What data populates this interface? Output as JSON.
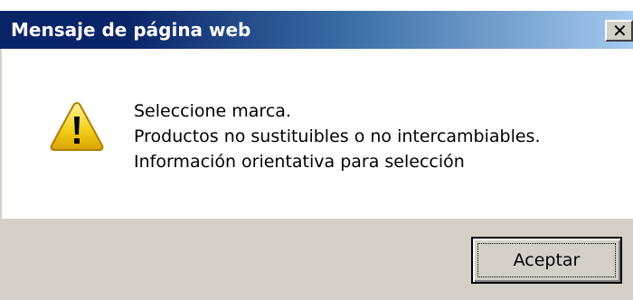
{
  "dialog": {
    "title": "Mensaje de página web",
    "close_glyph": "✕",
    "icon": "warning-icon",
    "message_lines": [
      "Seleccione marca.",
      "Productos no sustituibles o no intercambiables.",
      "Información orientativa para selección"
    ],
    "ok_label": "Aceptar"
  },
  "colors": {
    "titlebar_start": "#0a246a",
    "titlebar_end": "#a6caf0",
    "face": "#d4d0c8",
    "warning_yellow": "#f5d21b"
  }
}
